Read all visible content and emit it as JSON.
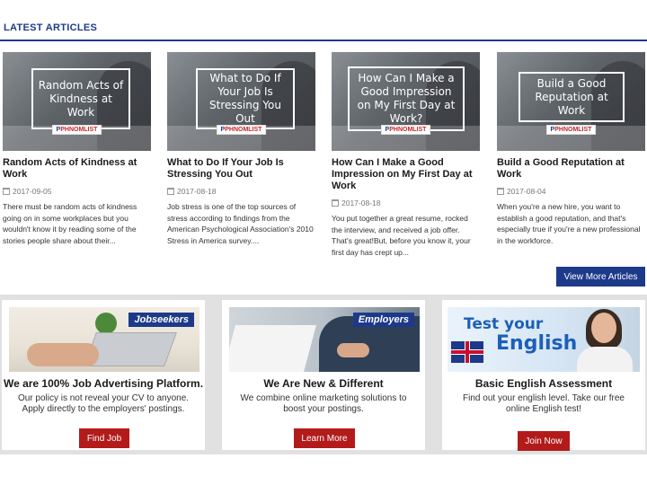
{
  "section": {
    "title": "LATEST ARTICLES"
  },
  "brand_badge": "PHNOMLIST",
  "articles": [
    {
      "thumb_text": "Random Acts of Kindness at Work",
      "title": "Random Acts of Kindness at Work",
      "date": "2017-09-05",
      "excerpt": "There must be random acts of kindness going on in some workplaces but you wouldn't know it by reading some of the stories people share about their..."
    },
    {
      "thumb_text": "What to Do If Your Job Is Stressing You Out",
      "title": "What to Do If Your Job Is Stressing You Out",
      "date": "2017-08-18",
      "excerpt": "Job stress is one of the top sources of stress according to findings from the American Psychological Association's 2010 Stress in America survey...."
    },
    {
      "thumb_text": "How Can I Make a Good Impression on My First Day at Work?",
      "title": "How Can I Make a Good Impression on My First Day at Work",
      "date": "2017-08-18",
      "excerpt": "You put together a great resume, rocked the interview, and received a job offer. That's great!But, before you know it, your first day has crept up..."
    },
    {
      "thumb_text": "Build a Good Reputation at Work",
      "title": "Build a Good Reputation at Work",
      "date": "2017-08-04",
      "excerpt": "When you're a new hire, you want to establish a good reputation, and that's especially true if you're a new professional in the workforce."
    }
  ],
  "view_more_label": "View More Articles",
  "cards": [
    {
      "tag": "Jobseekers",
      "title": "We are 100% Job Advertising Platform.",
      "desc": "Our policy is not reveal your CV to anyone. Apply directly to the employers' postings.",
      "button": "Find Job"
    },
    {
      "tag": "Employers",
      "title": "We Are New & Different",
      "desc": "We combine online marketing solutions to boost your postings.",
      "button": "Learn More"
    },
    {
      "banner_line1": "Test your",
      "banner_line2": "English",
      "title": "Basic English Assessment",
      "desc": "Find out your english level. Take our free online English test!",
      "button": "Join Now"
    }
  ],
  "colors": {
    "accent": "#1d3a8a",
    "button_red": "#b31b1b",
    "band_gray": "#e1e1e1"
  }
}
